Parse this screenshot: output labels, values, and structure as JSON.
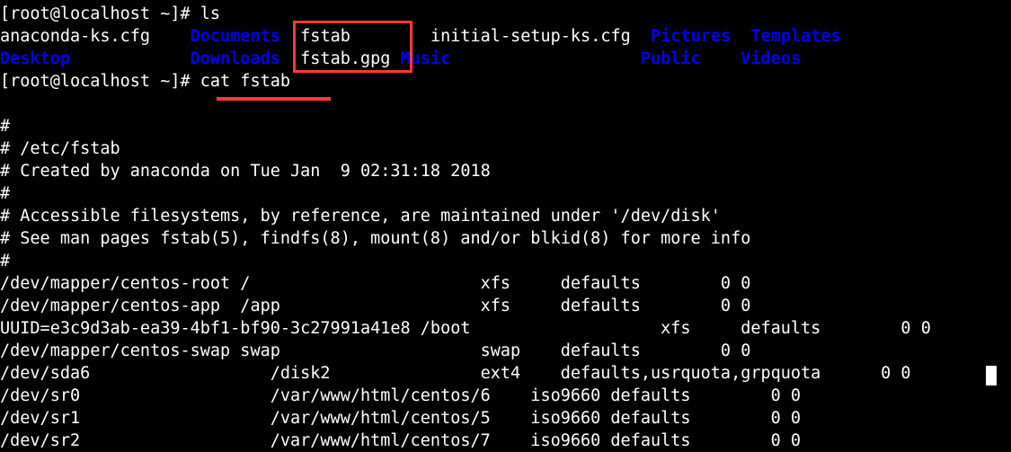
{
  "terminal": {
    "background_color": "#000000",
    "foreground_color": "#ffffff",
    "directory_color": "#0000ee",
    "annotation_color": "#ff3b30",
    "prompt": "[root@localhost ~]# ",
    "commands": {
      "first": "ls",
      "second": "cat fstab"
    },
    "prompt_line_1": "[root@localhost ~]# ls",
    "prompt_line_2": "[root@localhost ~]# cat fstab",
    "ls_output": {
      "row1": {
        "col1": "anaconda-ks.cfg",
        "col2": "Documents",
        "col3": "fstab",
        "col4": "initial-setup-ks.cfg",
        "col5": "Pictures",
        "col6": "Templates"
      },
      "row2": {
        "col1": "Desktop",
        "col2": "Downloads",
        "col3": "fstab.gpg",
        "col4": "Music",
        "col5": "Public",
        "col6": "Videos"
      }
    },
    "fstab": {
      "blank_line": "",
      "comments": [
        "#",
        "# /etc/fstab",
        "# Created by anaconda on Tue Jan  9 02:31:18 2018",
        "#",
        "# Accessible filesystems, by reference, are maintained under '/dev/disk'",
        "# See man pages fstab(5), findfs(8), mount(8) and/or blkid(8) for more info",
        "#"
      ],
      "entries": [
        "/dev/mapper/centos-root /                       xfs     defaults        0 0",
        "/dev/mapper/centos-app  /app                    xfs     defaults        0 0",
        "UUID=e3c9d3ab-ea39-4bf1-bf90-3c27991a41e8 /boot                   xfs     defaults        0 0",
        "/dev/mapper/centos-swap swap                    swap    defaults        0 0",
        "/dev/sda6                  /disk2               ext4    defaults,usrquota,grpquota      0 0",
        "/dev/sr0                   /var/www/html/centos/6    iso9660 defaults        0 0",
        "/dev/sr1                   /var/www/html/centos/5    iso9660 defaults        0 0",
        "/dev/sr2                   /var/www/html/centos/7    iso9660 defaults        0 0"
      ]
    },
    "annotations": {
      "highlight_box_label": "fstab-files-highlight",
      "underline_label": "cat-fstab-underline",
      "cursor_label": "text-cursor"
    }
  }
}
